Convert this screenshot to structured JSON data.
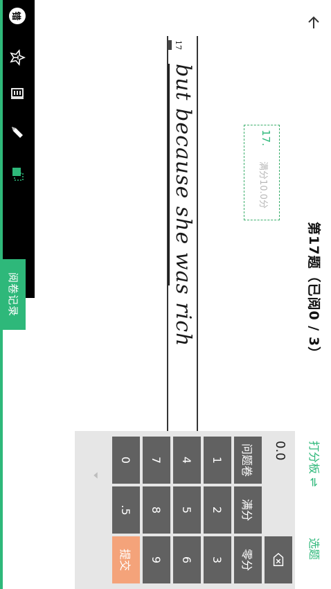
{
  "header": {
    "back_icon": "arrow-left-icon",
    "title": "第17题（已阅0 / 3）",
    "scorepad_toggle": "打分板 ⇌",
    "select_question": "选题"
  },
  "answer": {
    "question_number": "17",
    "handwriting": "but because she was rich",
    "score_box": {
      "number": "17.",
      "full_score": "满分10.0分"
    }
  },
  "toolbar": {
    "tools": [
      "error-mark-icon",
      "excellent-mark-icon",
      "annotation-icon",
      "pen-icon",
      "eraser-icon"
    ],
    "error_label": "错"
  },
  "records_tab": "阅卷记录",
  "scorepad": {
    "display": "0.0",
    "keys": {
      "problem": "问题卷",
      "full": "满分",
      "zero": "零分",
      "k1": "1",
      "k2": "2",
      "k3": "3",
      "k4": "4",
      "k5": "5",
      "k6": "6",
      "k7": "7",
      "k8": "8",
      "k9": "9",
      "k0": "0",
      "kdot": ".5",
      "submit": "提交"
    }
  },
  "colors": {
    "accent": "#2eb87a",
    "key_gray": "#616161",
    "submit": "#f4a37a",
    "toolbar": "#000000"
  }
}
